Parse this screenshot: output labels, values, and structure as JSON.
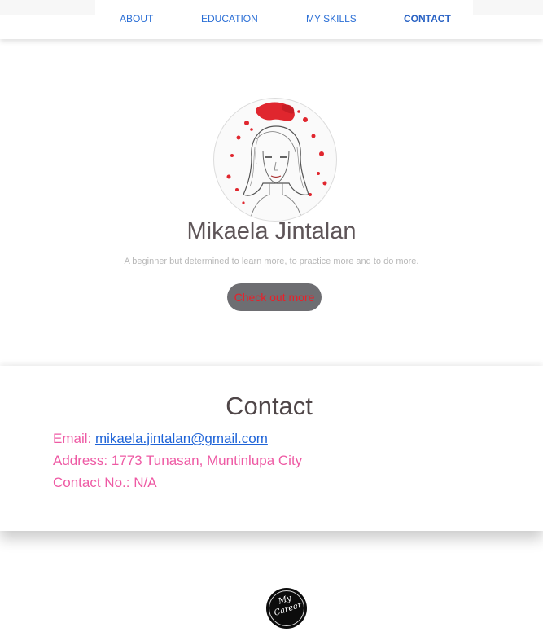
{
  "nav": {
    "items": [
      {
        "label": "ABOUT"
      },
      {
        "label": "EDUCATION"
      },
      {
        "label": "MY SKILLS"
      },
      {
        "label": "CONTACT"
      }
    ],
    "active": "CONTACT",
    "link_color": "#2b6fd6"
  },
  "hero": {
    "avatar_icon": "sketch-portrait-with-red-splatter",
    "name": "Mikaela Jintalan",
    "tagline": "A beginner but determined to learn more, to practice more and to do more.",
    "cta_label": "Check out more"
  },
  "contact": {
    "title": "Contact",
    "email_label": "Email: ",
    "email_value": "mikaela.jintalan@gmail.com",
    "address_label": "Address: ",
    "address_value": "1773 Tunasan, Muntinlupa City",
    "phone_label": "Contact No.: ",
    "phone_value": "N/A",
    "label_color": "#ee5aa4",
    "link_color": "#1f64d8"
  },
  "footer": {
    "logo_line1": "My",
    "logo_line2": "Career"
  }
}
